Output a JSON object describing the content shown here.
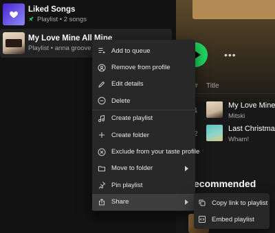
{
  "library": {
    "items": [
      {
        "title": "Liked Songs",
        "subtitle": "Playlist • 2 songs",
        "pinned": true
      },
      {
        "title": "My Love Mine All Mine",
        "subtitle": "Playlist • anna groove",
        "pinned": false
      }
    ]
  },
  "main": {
    "column_hash": "#",
    "column_title": "Title",
    "tracks": [
      {
        "num": "1",
        "title": "My Love Mine A",
        "artist": "Mitski"
      },
      {
        "num": "2",
        "title": "Last Christmas",
        "artist": "Wham!"
      }
    ],
    "recommended_heading": "ecommended"
  },
  "context_menu": {
    "items": [
      {
        "label": "Add to queue",
        "icon": "add-to-queue-icon"
      },
      {
        "label": "Remove from profile",
        "icon": "profile-icon"
      },
      {
        "label": "Edit details",
        "icon": "pencil-icon"
      },
      {
        "label": "Delete",
        "icon": "minus-circle-icon"
      },
      {
        "label": "Create playlist",
        "icon": "music-note-icon"
      },
      {
        "label": "Create folder",
        "icon": "plus-icon"
      },
      {
        "label": "Exclude from your taste profile",
        "icon": "exclude-icon"
      },
      {
        "label": "Move to folder",
        "icon": "folder-icon"
      },
      {
        "label": "Pin playlist",
        "icon": "pin-icon"
      },
      {
        "label": "Share",
        "icon": "share-icon"
      }
    ],
    "submenu": [
      {
        "label": "Copy link to playlist",
        "icon": "copy-link-icon"
      },
      {
        "label": "Embed playlist",
        "icon": "embed-icon"
      }
    ]
  },
  "colors": {
    "accent": "#1ed760",
    "menu_bg": "#282828",
    "highlight": "#3e3e3e"
  }
}
